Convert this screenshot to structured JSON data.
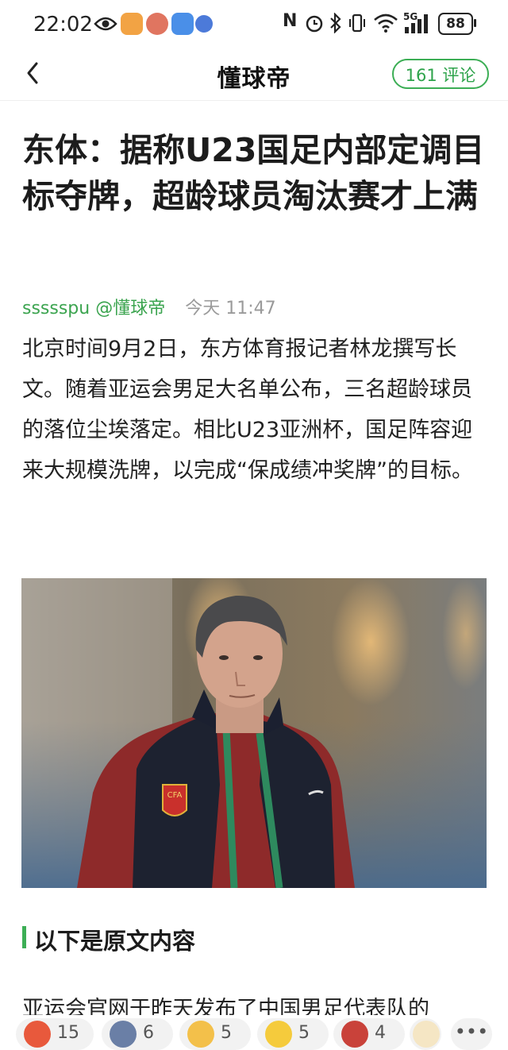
{
  "status_bar": {
    "time": "22:02",
    "signal_5g": "5G",
    "battery": "88"
  },
  "nav": {
    "title": "懂球帝",
    "comment_button": "161 评论"
  },
  "article": {
    "headline": "东体：据称U23国足内部定调目标夺牌，超龄球员淘汰赛才上满",
    "author": "ssssspu @懂球帝",
    "time": "今天 11:47",
    "paragraph": "北京时间9月2日，东方体育报记者林龙撰写长文。随着亚运会男足大名单公布，三名超龄球员的落位尘埃落定。相比U23亚洲杯，国足阵容迎来大规模洗牌，以完成“保成绩冲奖牌”的目标。",
    "section_title": "以下是原文内容",
    "paragraph2_cut": "亚运会官网于昨天发布了中国男足代表队的"
  },
  "photo": {
    "badge_text": "CFA"
  },
  "reactions": [
    {
      "icon": "clap-emoji-icon",
      "count": "15"
    },
    {
      "icon": "face-emoji-icon",
      "count": "6"
    },
    {
      "icon": "party-emoji-icon",
      "count": "5"
    },
    {
      "icon": "laugh-cry-emoji-icon",
      "count": "5"
    },
    {
      "icon": "angry-face-emoji-icon",
      "count": "4"
    }
  ],
  "colors": {
    "accent": "#3cae55",
    "author": "#3ba44f",
    "meta_gray": "#9a9a9a"
  }
}
